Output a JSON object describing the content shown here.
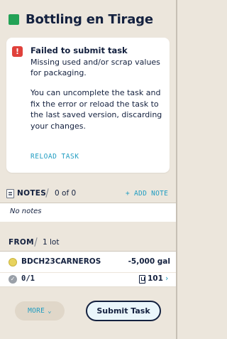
{
  "header": {
    "title": "Bottling en Tirage",
    "status_color": "#23a256"
  },
  "error": {
    "icon": "alert-icon",
    "icon_glyph": "!",
    "title": "Failed to submit task",
    "message": "Missing used and/or scrap values for packaging.",
    "help": "You can uncomplete the task and fix the error or reload the task to the last saved version, discarding your changes.",
    "reload_label": "RELOAD TASK"
  },
  "notes": {
    "label": "NOTES",
    "count": "0 of 0",
    "add_label": "+ ADD NOTE",
    "empty_text": "No notes"
  },
  "from": {
    "label": "FROM",
    "count": "1 lot",
    "lots": [
      {
        "code": "BDCH23CARNEROS",
        "volume": "-5,000 gal",
        "progress": "0/1",
        "barrels": "101",
        "dot_color": "#e8d35e"
      }
    ]
  },
  "footer": {
    "more_label": "MORE",
    "submit_label": "Submit Task"
  },
  "colors": {
    "accent": "#1f9cc1",
    "error": "#e0413b",
    "text": "#14213f",
    "background": "#ece6dc"
  }
}
